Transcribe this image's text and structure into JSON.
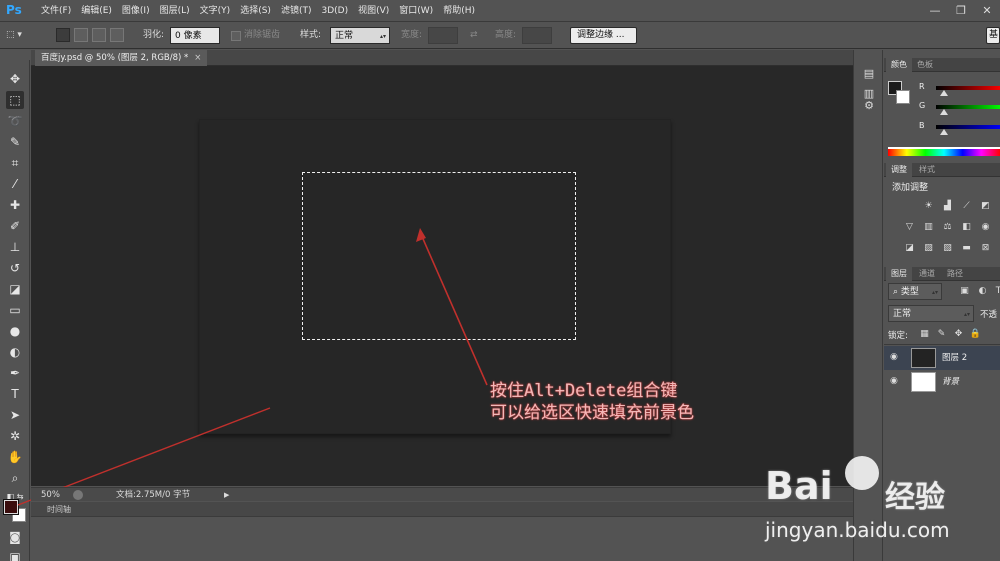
{
  "app": {
    "logo": "Ps"
  },
  "menu": [
    "文件(F)",
    "编辑(E)",
    "图像(I)",
    "图层(L)",
    "文字(Y)",
    "选择(S)",
    "滤镜(T)",
    "3D(D)",
    "视图(V)",
    "窗口(W)",
    "帮助(H)"
  ],
  "window_controls": {
    "minimize": "—",
    "restore": "❐",
    "close": "✕"
  },
  "options": {
    "feather_label": "羽化:",
    "feather_value": "0 像素",
    "antialias_label": "消除锯齿",
    "style_label": "样式:",
    "style_value": "正常",
    "width_label": "宽度:",
    "swap_icon": "⇄",
    "height_label": "高度:",
    "refine_edge_button": "调整边缘 ...",
    "workspace_button": "基"
  },
  "document": {
    "tab_title": "百度jy.psd @ 50% (图层 2, RGB/8) *",
    "tab_close": "×"
  },
  "annotation": {
    "line1": "按住Alt+Delete组合键",
    "line2": "可以给选区快速填充前景色"
  },
  "statusbar": {
    "zoom": "50%",
    "doc_info": "文档:2.75M/0 字节"
  },
  "timeline": {
    "tab": "时间轴"
  },
  "panels": {
    "color": {
      "tabs": [
        "颜色",
        "色板"
      ],
      "r_label": "R",
      "g_label": "G",
      "b_label": "B"
    },
    "adjustments": {
      "tabs": [
        "调整",
        "样式"
      ],
      "title": "添加调整"
    },
    "layers": {
      "tabs": [
        "图层",
        "通道",
        "路径"
      ],
      "filter_value": "类型",
      "blend_mode": "正常",
      "opacity_label": "不透",
      "lock_label": "锁定:",
      "items": [
        {
          "name": "图层 2",
          "selected": true
        },
        {
          "name": "背景",
          "selected": false
        }
      ]
    }
  },
  "watermark": {
    "brand": "Bai",
    "brand_suffix": "经验",
    "url": "jingyan.baidu.com"
  },
  "colors": {
    "foreground": "#3a0d0d",
    "background": "#ffffff",
    "annotation_red": "#c0302c",
    "canvas_bg": "#282828"
  }
}
